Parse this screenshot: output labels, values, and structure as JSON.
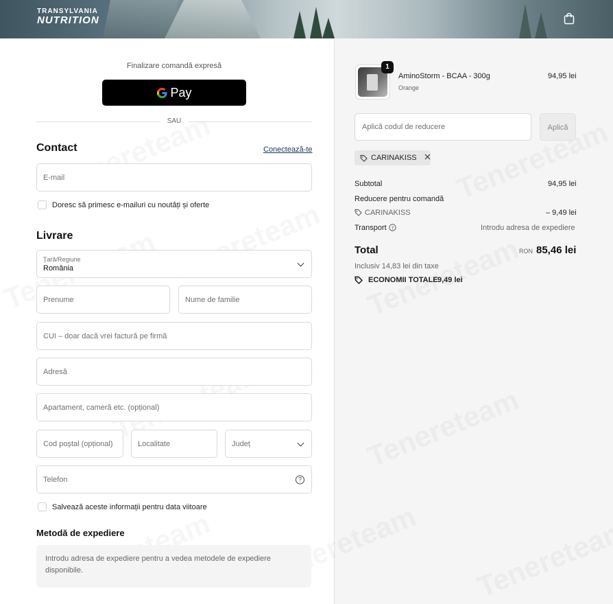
{
  "header": {
    "logo_line1": "TRANSYLVANIA",
    "logo_line2": "NUTRITION",
    "cart_icon": "shopping-bag-icon"
  },
  "express": {
    "label": "Finalizare comandă expresă",
    "gpay_label": "Pay",
    "divider": "SAU"
  },
  "contact": {
    "title": "Contact",
    "login_link": "Conectează-te",
    "email_placeholder": "E-mail",
    "newsletter_label": "Doresc să primesc e-mailuri cu noutăți și oferte"
  },
  "delivery": {
    "title": "Livrare",
    "country_label": "Țară/Regiune",
    "country_value": "România",
    "first_name": "Prenume",
    "last_name": "Nume de familie",
    "cui": "CUI – doar dacă vrei factură pe firmă",
    "address": "Adresă",
    "apartment": "Apartament, cameră etc. (opțional)",
    "postal": "Cod poștal (opțional)",
    "city": "Localitate",
    "county": "Județ",
    "phone": "Telefon",
    "save_label": "Salvează aceste informații pentru data viitoare"
  },
  "shipping": {
    "title": "Metodă de expediere",
    "info": "Introdu adresa de expediere pentru a vedea metodele de expediere disponibile."
  },
  "summary": {
    "item": {
      "qty": "1",
      "name": "AminoStorm - BCAA - 300g",
      "variant": "Orange",
      "price": "94,95 lei"
    },
    "discount_placeholder": "Aplică codul de reducere",
    "apply_label": "Aplică",
    "code_chip": "CARINAKISS",
    "subtotal_label": "Subtotal",
    "subtotal_value": "94,95 lei",
    "order_discount_label": "Reducere pentru comandă",
    "discount_code": "CARINAKISS",
    "discount_value": "– 9,49 lei",
    "transport_label": "Transport",
    "transport_value": "Introdu adresa de expediere",
    "total_label": "Total",
    "total_currency": "RON",
    "total_value": "85,46 lei",
    "tax_note": "Inclusiv 14,83 lei din taxe",
    "savings_label": "ECONOMII TOTALE",
    "savings_value": "9,49 lei"
  },
  "watermark": "Tenereteam"
}
